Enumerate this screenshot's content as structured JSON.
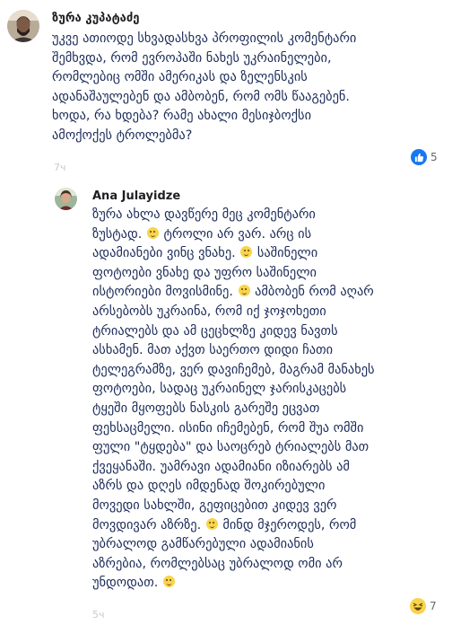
{
  "comments": [
    {
      "author": "ზურა კუპატაძე",
      "lines": [
        "უკვე ათიოდე სხვადასხვა პროფილის კომენტარი",
        "შემხვდა, რომ ევროპაში ნახეს უკრაინელები,",
        "რომლებიც ომში ამერიკას და ზელენსკის",
        "ადანაშაულებენ და ამბობენ, რომ ომს წააგებენ.",
        "ხოდა, რა ხდება? რამე ახალი მესიჯბოქსი",
        "ამოქოქეს ტროლებმა?"
      ],
      "time": "7ч",
      "reaction_icon": "like-icon",
      "reaction_count": "5",
      "colors": {
        "like": "#1877f2"
      }
    },
    {
      "author": "Ana Julayidze",
      "lines": [
        "ზურა ახლა დავწერე მეც კომენტარი",
        "ზუსტად. [e] ტროლი არ ვარ. არც ის",
        "ადამიანები ვინც ვნახე. [e] საშინელი",
        "ფოტოები ვნახე და უფრო საშინელი",
        "ისტორიები მოვისმინე. [e] ამბობენ რომ აღარ",
        "არსებობს უკრაინა, რომ იქ ჯოჯოხეთი",
        "ტრიალებს და ამ ცეცხლზე კიდევ ნავთს",
        "ასხამენ. მათ აქვთ საერთო დიდი ჩათი",
        "ტელეგრამზე, ვერ დავიჩემებ, მაგრამ მანახეს",
        "ფოტოები, სადაც უკრაინელ ჯარისკაცებს",
        "ტყეში მყოფებს ნასკის გარეშე ეცვათ",
        "ფეხსაცმელი. ისინი იჩემებენ, რომ შუა ომში",
        "ფული \"ტყდება\" და საოცრებ ტრიალებს მათ",
        "ქვეყანაში. უამრავი ადამიანი იზიარებს ამ",
        "აზრს და დღეს იმდენად შოკირებული",
        "მოვედი სახლში, გეფიცებით კიდევ ვერ",
        "მოვდივარ აზრზე. [e] მინდ მჯეროდეს, რომ",
        "უბრალოდ გამწარებული ადამიანის",
        "აზრებია, რომლებსაც უბრალოდ ომი არ",
        "უნდოდათ. [e]"
      ],
      "time": "5ч",
      "reaction_icon": "laughing-emoji-icon",
      "reaction_count": "7",
      "colors": {
        "haha": "#f7d44c"
      }
    }
  ]
}
